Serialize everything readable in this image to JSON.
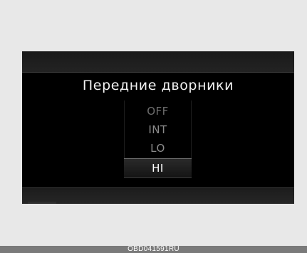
{
  "screen": {
    "title": "Передние дворники",
    "options": [
      "OFF",
      "INT",
      "LO",
      "HI"
    ],
    "selected": "HI"
  },
  "footer": {
    "code": "OBD041591RU"
  }
}
